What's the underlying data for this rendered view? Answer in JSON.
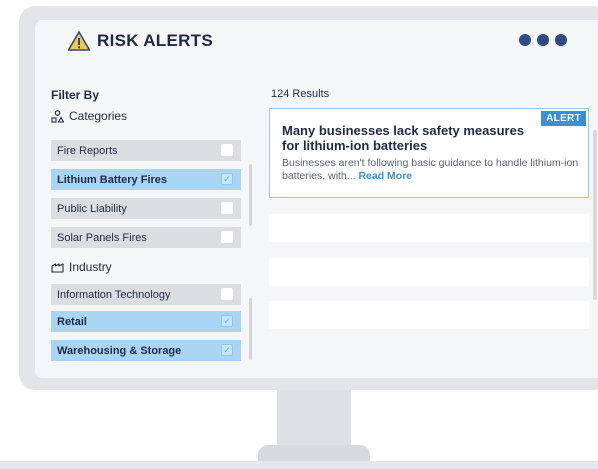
{
  "app": {
    "title": "RISK ALERTS",
    "title_icon": "warning-triangle-icon",
    "menu_icon": "more-dots-icon",
    "accent_color": "#2f4b84"
  },
  "filters": {
    "title": "Filter By",
    "categories": {
      "heading": "Categories",
      "icon": "categories-icon",
      "items": [
        {
          "label": "Fire Reports",
          "checked": false
        },
        {
          "label": "Lithium Battery Fires",
          "checked": true
        },
        {
          "label": "Public Liability",
          "checked": false
        },
        {
          "label": "Solar Panels Fires",
          "checked": false
        }
      ]
    },
    "industry": {
      "heading": "Industry",
      "icon": "industry-icon",
      "items": [
        {
          "label": "Information Technology",
          "checked": false
        },
        {
          "label": "Retail",
          "checked": true
        },
        {
          "label": "Warehousing & Storage",
          "checked": true
        }
      ]
    },
    "selected_color": "#a9d5f3"
  },
  "results": {
    "count_label": "124 Results",
    "cards": [
      {
        "badge": "ALERT",
        "headline": "Many businesses lack safety measures for lithium-ion batteries",
        "summary": "Businesses aren't following basic guidance to handle lithium-ion batteries, with...",
        "read_more": "Read More"
      }
    ],
    "badge_color": "#3b8fd6"
  }
}
